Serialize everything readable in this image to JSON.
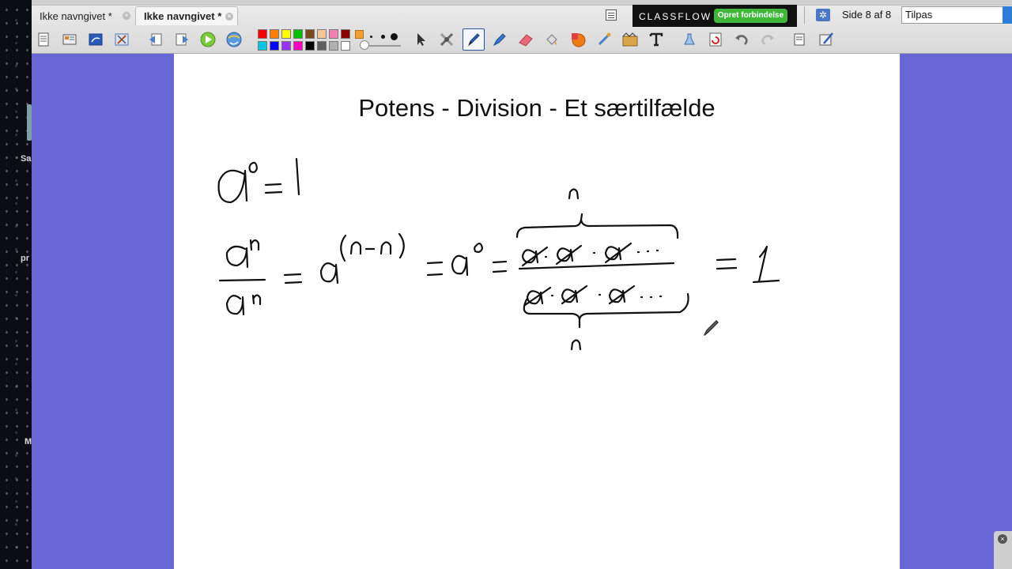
{
  "desktop": {
    "labels": [
      "Sa",
      "pr",
      "M"
    ]
  },
  "tabs": [
    {
      "label": "Ikke navngivet *",
      "active": false
    },
    {
      "label": "Ikke navngivet *",
      "active": true
    }
  ],
  "classflow": {
    "logo": "CLASSFLOW",
    "connect_button": "Opret forbindelse",
    "accent_color": "#3fb83a"
  },
  "page_indicator": "Side 8 af 8",
  "zoom": {
    "value": "Tilpas"
  },
  "toolbar": {
    "tools_left": [
      "page-browser-icon",
      "resource-browser-icon",
      "flipchart-icon",
      "tools-icon",
      "previous-page-icon",
      "next-page-icon",
      "play-icon",
      "internet-icon"
    ],
    "tools_right": [
      "select-icon",
      "multi-tool-icon",
      "pen-icon",
      "highlighter-icon",
      "eraser-icon",
      "fill-icon",
      "shape-icon",
      "connector-icon",
      "clip-icon",
      "text-icon",
      "clear-icon",
      "reset-page-icon",
      "undo-icon",
      "redo-icon",
      "notes-icon",
      "customize-icon"
    ],
    "colors_row1": [
      "#ff0000",
      "#ff7f00",
      "#ffff00",
      "#00c000",
      "#7a4a1a",
      "#f5c89a",
      "#f47fb2",
      "#8b0000"
    ],
    "colors_row2": [
      "#00c8e0",
      "#0000ff",
      "#9b30ff",
      "#ff00c0",
      "#000000",
      "#606060",
      "#b0b0b0",
      "#ffffff"
    ]
  },
  "page": {
    "title": "Potens - Division - Et særtilfælde",
    "background": "#ffffff",
    "surround_color": "#6966d6"
  }
}
